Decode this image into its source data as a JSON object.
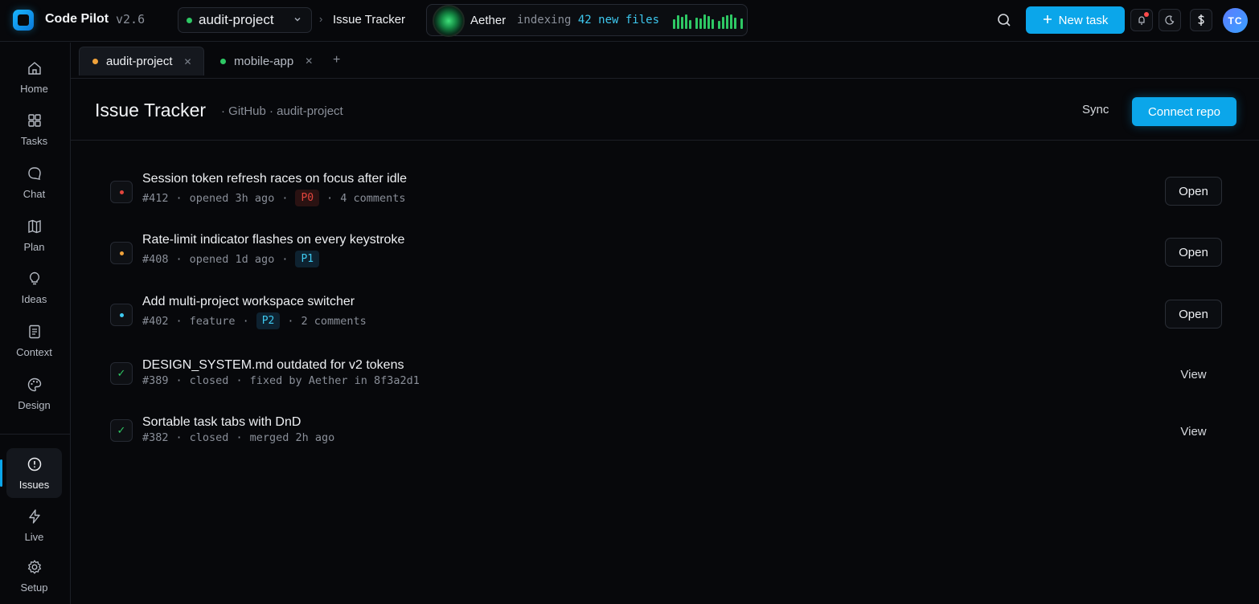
{
  "app": {
    "name": "Code Pilot",
    "version": "v2.6"
  },
  "project_selector": {
    "label": "audit-project"
  },
  "breadcrumb": {
    "current": "Issue Tracker"
  },
  "agent": {
    "name": "Aether",
    "status_prefix": "indexing",
    "status_count": "42 new files",
    "activity_level": [
      0.6,
      0.85,
      0.75,
      0.9,
      0.55,
      0.7,
      0.65,
      0.9,
      0.8,
      0.6,
      0.5,
      0.75,
      0.85,
      0.9,
      0.7,
      0.65
    ]
  },
  "topbar": {
    "new_task_label": "New task",
    "avatar_initials": "TC",
    "icons": [
      "search-icon",
      "notification-icon",
      "theme-toggle-icon",
      "billing-icon"
    ]
  },
  "sidebar": {
    "items": [
      {
        "label": "Home",
        "icon": "home-icon"
      },
      {
        "label": "Tasks",
        "icon": "grid-icon"
      },
      {
        "label": "Chat",
        "icon": "chat-icon"
      },
      {
        "label": "Plan",
        "icon": "map-icon"
      },
      {
        "label": "Ideas",
        "icon": "lightbulb-icon"
      },
      {
        "label": "Context",
        "icon": "document-icon"
      },
      {
        "label": "Design",
        "icon": "palette-icon"
      },
      {
        "label": "Issues",
        "icon": "alert-circle-icon",
        "active": true
      },
      {
        "label": "Live",
        "icon": "lightning-icon"
      },
      {
        "label": "Setup",
        "icon": "gear-icon"
      }
    ]
  },
  "workspace_tabs": [
    {
      "label": "audit-project",
      "status": "amber",
      "active": true
    },
    {
      "label": "mobile-app",
      "status": "green",
      "active": false
    }
  ],
  "page": {
    "title": "Issue Tracker",
    "subtitle": "· GitHub · audit-project",
    "sync_label": "Sync",
    "connect_label": "Connect repo"
  },
  "issues": [
    {
      "title": "Session token refresh races on focus after idle",
      "number": "#412",
      "detail": "opened 3h ago",
      "priority": "P0",
      "extra": "4 comments",
      "state": "open",
      "action": "Open",
      "color": "#e2453d"
    },
    {
      "title": "Rate-limit indicator flashes on every keystroke",
      "number": "#408",
      "detail": "opened 1d ago",
      "priority": "P1",
      "extra": "",
      "state": "open",
      "action": "Open",
      "color": "#f0a23a"
    },
    {
      "title": "Add multi-project workspace switcher",
      "number": "#402",
      "detail": "feature",
      "priority": "P2",
      "extra": "2 comments",
      "state": "open",
      "action": "Open",
      "color": "#3ec9f0"
    },
    {
      "title": "DESIGN_SYSTEM.md outdated for v2 tokens",
      "number": "#389",
      "detail": "closed",
      "priority": "",
      "extra": "fixed by Aether in 8f3a2d1",
      "state": "closed",
      "action": "View",
      "color": "#2ec864"
    },
    {
      "title": "Sortable task tabs with DnD",
      "number": "#382",
      "detail": "closed",
      "priority": "",
      "extra": "merged 2h ago",
      "state": "closed",
      "action": "View",
      "color": "#2ec864"
    }
  ],
  "colors": {
    "accent": "#0ba6ea",
    "background": "#07080b",
    "success": "#2ec864",
    "danger": "#e2453d",
    "warning": "#f0a23a"
  }
}
